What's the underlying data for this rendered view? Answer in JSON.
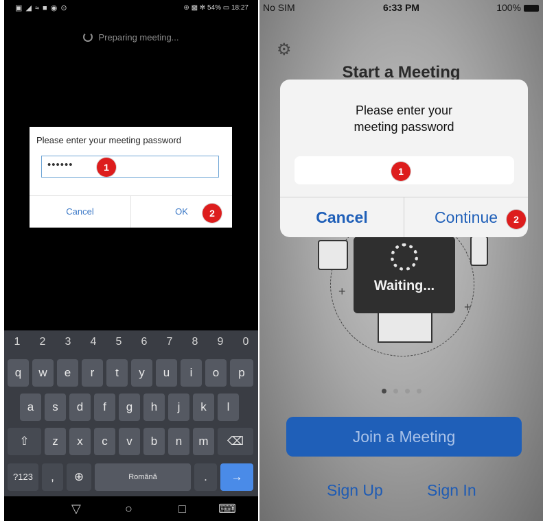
{
  "android": {
    "status_left": "▣ ◢ ≈ ■ ◉ ⊙",
    "status_right": "⊛ ▩ ✻ 54% ▭ 18:27",
    "preparing_text": "Preparing meeting...",
    "dialog": {
      "title": "Please enter your meeting password",
      "password_value": "••••••",
      "cancel_label": "Cancel",
      "ok_label": "OK"
    },
    "badges": [
      "1",
      "2"
    ],
    "keyboard": {
      "number_row": [
        "1",
        "2",
        "3",
        "4",
        "5",
        "6",
        "7",
        "8",
        "9",
        "0"
      ],
      "row1": [
        "q",
        "w",
        "e",
        "r",
        "t",
        "y",
        "u",
        "i",
        "o",
        "p"
      ],
      "row2": [
        "a",
        "s",
        "d",
        "f",
        "g",
        "h",
        "j",
        "k",
        "l"
      ],
      "row3": [
        "z",
        "x",
        "c",
        "v",
        "b",
        "n",
        "m"
      ],
      "symbols_label": "?123",
      "comma_label": ",",
      "space_label": "Română",
      "period_label": ".",
      "shift_glyph": "⇧",
      "backspace_glyph": "⌫",
      "globe_glyph": "⊕",
      "enter_glyph": "→"
    },
    "nav": {
      "back": "▽",
      "home": "○",
      "recents": "□",
      "keyboard": "⌨"
    }
  },
  "ios": {
    "status": {
      "carrier": "No SIM",
      "time": "6:33 PM",
      "battery": "100%"
    },
    "settings_glyph": "⚙",
    "title": "Start a Meeting",
    "dialog": {
      "title_line1": "Please enter your",
      "title_line2": "meeting password",
      "cancel_label": "Cancel",
      "continue_label": "Continue"
    },
    "waiting_text": "Waiting...",
    "badges": [
      "1",
      "2"
    ],
    "join_label": "Join a Meeting",
    "sign_up_label": "Sign Up",
    "sign_in_label": "Sign In",
    "page_dots": 4,
    "active_dot": 1
  },
  "colors": {
    "badge": "#dd1d1d",
    "android_link": "#3c79c7",
    "ios_accent": "#1f5fb8"
  }
}
